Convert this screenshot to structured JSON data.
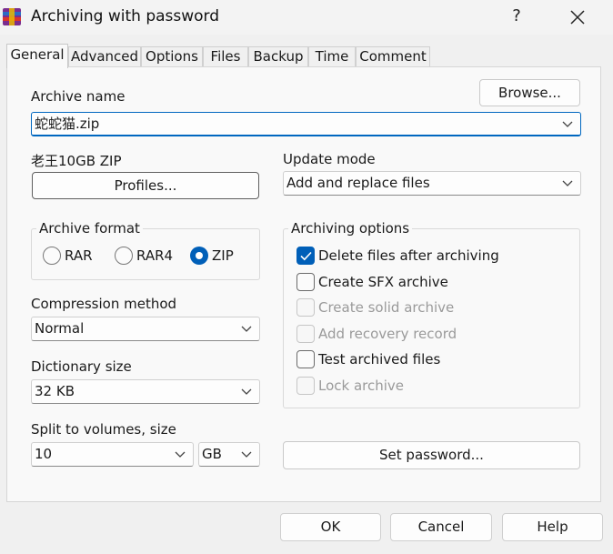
{
  "window": {
    "title": "Archiving with password",
    "help_label": "?"
  },
  "tabs": [
    {
      "label": "General",
      "active": true
    },
    {
      "label": "Advanced"
    },
    {
      "label": "Options"
    },
    {
      "label": "Files"
    },
    {
      "label": "Backup"
    },
    {
      "label": "Time"
    },
    {
      "label": "Comment"
    }
  ],
  "archive": {
    "name_label": "Archive name",
    "name_value": "蛇蛇猫.zip",
    "browse_label": "Browse..."
  },
  "profile": {
    "name": "老王10GB ZIP",
    "profiles_label": "Profiles..."
  },
  "update_mode": {
    "label": "Update mode",
    "value": "Add and replace files"
  },
  "archive_format": {
    "label": "Archive format",
    "options": [
      "RAR",
      "RAR4",
      "ZIP"
    ],
    "selected": "ZIP"
  },
  "compression": {
    "label": "Compression method",
    "value": "Normal"
  },
  "dictionary": {
    "label": "Dictionary size",
    "value": "32 KB"
  },
  "split": {
    "label": "Split to volumes, size",
    "value": "10",
    "unit": "GB"
  },
  "archiving_options": {
    "label": "Archiving options",
    "items": [
      {
        "label": "Delete files after archiving",
        "checked": true,
        "enabled": true
      },
      {
        "label": "Create SFX archive",
        "checked": false,
        "enabled": true
      },
      {
        "label": "Create solid archive",
        "checked": false,
        "enabled": false
      },
      {
        "label": "Add recovery record",
        "checked": false,
        "enabled": false
      },
      {
        "label": "Test archived files",
        "checked": false,
        "enabled": true
      },
      {
        "label": "Lock archive",
        "checked": false,
        "enabled": false
      }
    ]
  },
  "set_password_label": "Set password...",
  "footer": {
    "ok": "OK",
    "cancel": "Cancel",
    "help": "Help"
  },
  "colors": {
    "accent": "#005fb8",
    "window_bg": "#f0f0f0",
    "panel_bg": "#f9f9f9"
  }
}
